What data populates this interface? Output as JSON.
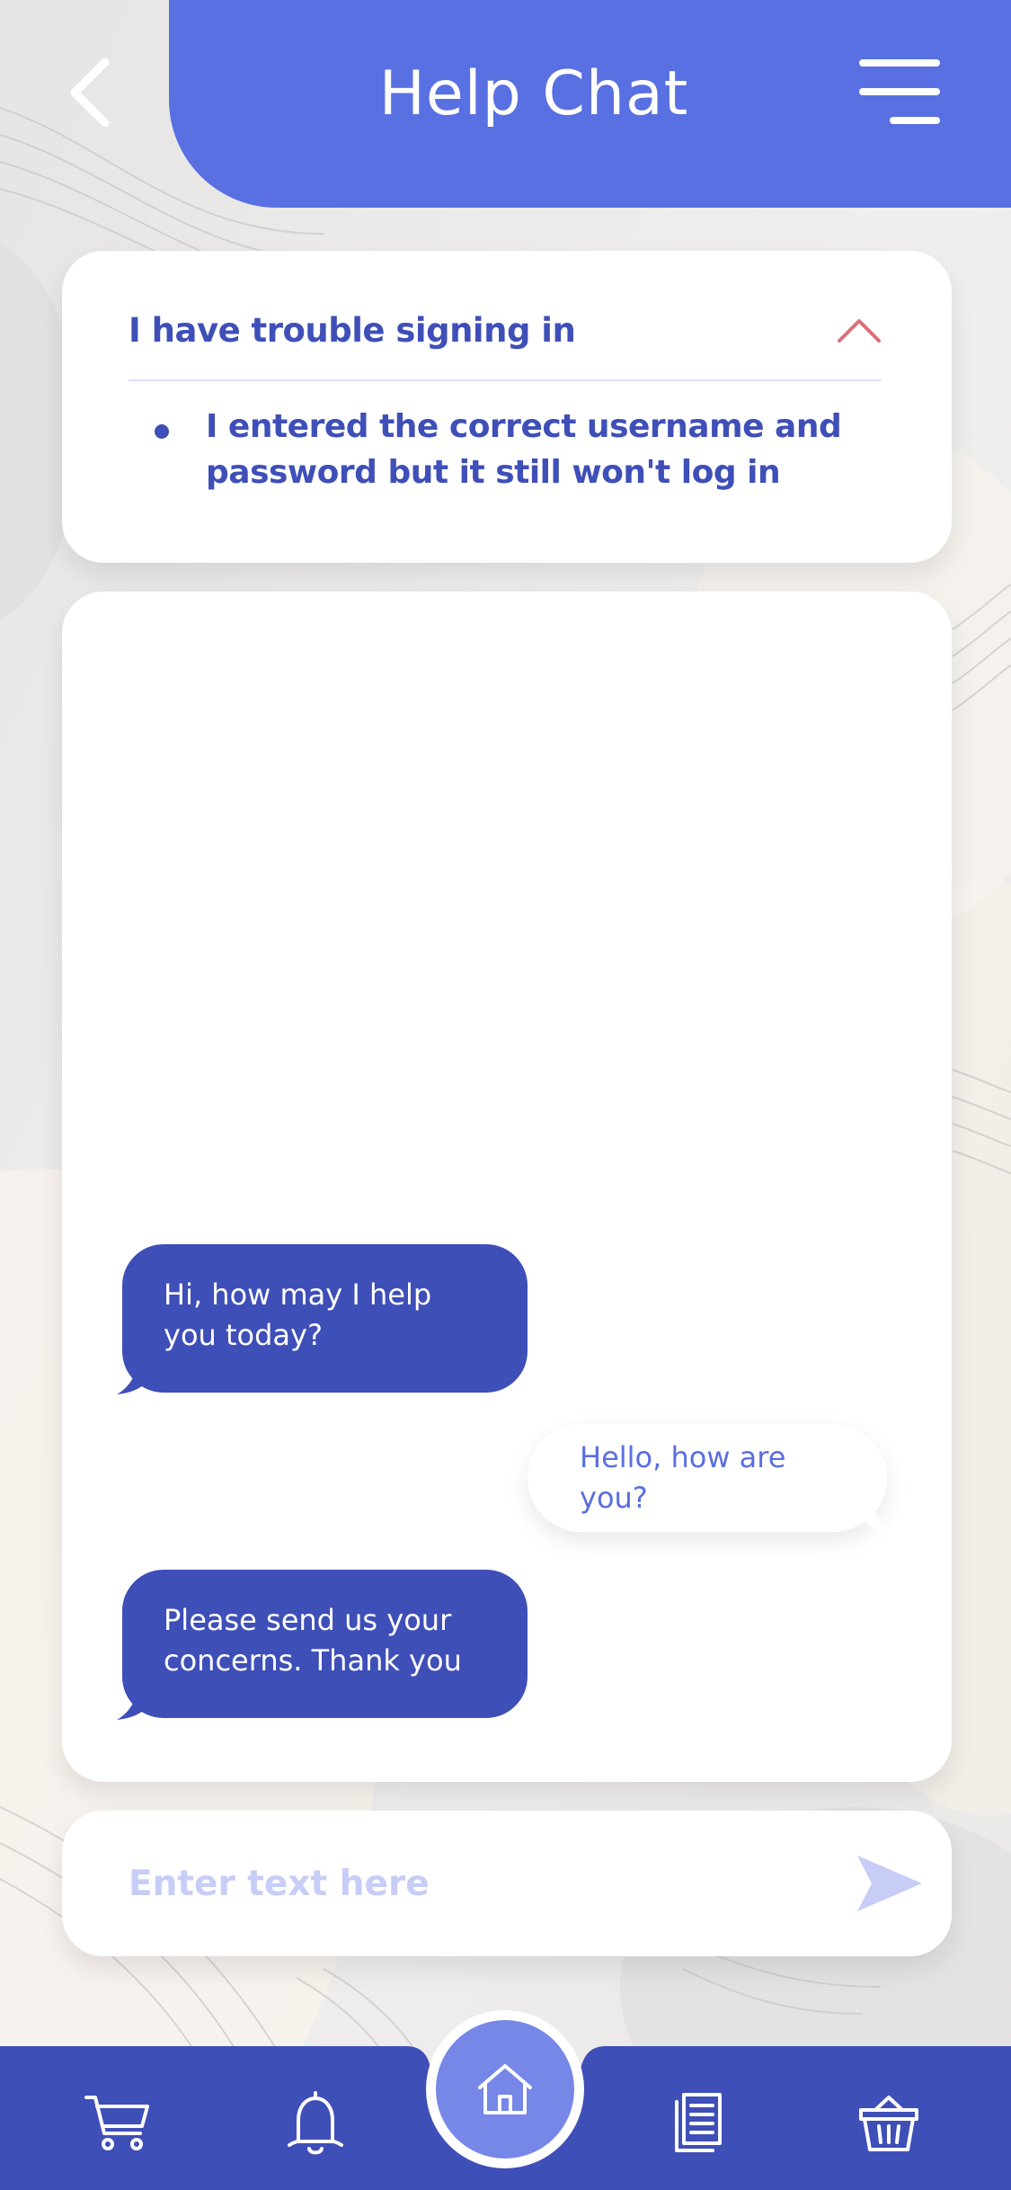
{
  "header": {
    "title": "Help Chat"
  },
  "faq": {
    "question": "I have trouble signing in",
    "answer": "I entered the correct username and password but it still won't log in"
  },
  "chat": {
    "messages": [
      {
        "sender": "support",
        "text": "Hi, how may I help you today?"
      },
      {
        "sender": "user",
        "text": "Hello, how are you?"
      },
      {
        "sender": "support",
        "text": "Please send us your concerns. Thank you"
      }
    ]
  },
  "composer": {
    "placeholder": "Enter text here",
    "value": ""
  },
  "bottom_nav": {
    "items": [
      "cart-icon",
      "bell-icon",
      "home-icon",
      "document-icon",
      "basket-icon"
    ],
    "active": "home-icon"
  },
  "colors": {
    "primary": "#5870e2",
    "bubble": "#3f4fb8",
    "nav": "#3f4fb8",
    "accent_chevron": "#d9707a",
    "placeholder": "#c7cdf6"
  }
}
